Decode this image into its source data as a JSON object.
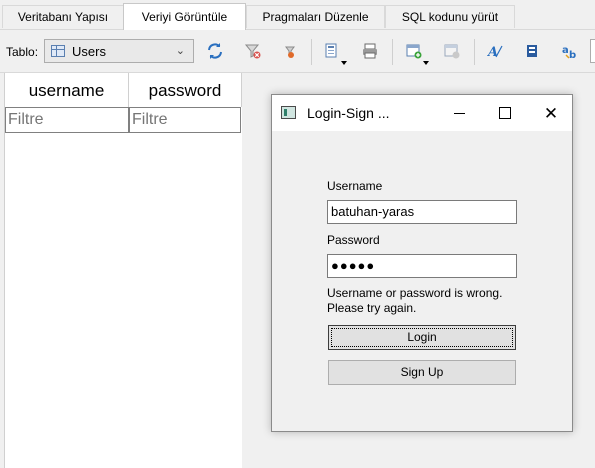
{
  "tabs": [
    {
      "label": "Veritabanı Yapısı",
      "active": false
    },
    {
      "label": "Veriyi Görüntüle",
      "active": true
    },
    {
      "label": "Pragmaları Düzenle",
      "active": false
    },
    {
      "label": "SQL kodunu yürüt",
      "active": false
    }
  ],
  "toolbar": {
    "table_label": "Tablo:",
    "table_select": "Users",
    "icons": [
      "refresh-icon",
      "clear-filter-icon",
      "save-filter-icon",
      "copy-icon",
      "print-icon",
      "insert-record-icon",
      "delete-record-icon",
      "text-format-icon",
      "binary-icon",
      "replace-icon"
    ]
  },
  "grid": {
    "columns": [
      "username",
      "password"
    ],
    "filter_placeholder": "Filtre"
  },
  "dialog": {
    "title": "Login-Sign ...",
    "username_label": "Username",
    "username_value": "batuhan-yaras",
    "password_label": "Password",
    "password_value": "●●●●●",
    "message_line1": "Username or password is wrong.",
    "message_line2": "Please try again.",
    "login_label": "Login",
    "signup_label": "Sign Up"
  },
  "colors": {
    "background": "#f0f0f0",
    "refresh_icon": "#2a6fbf",
    "filter_clear": "#d9534f"
  }
}
